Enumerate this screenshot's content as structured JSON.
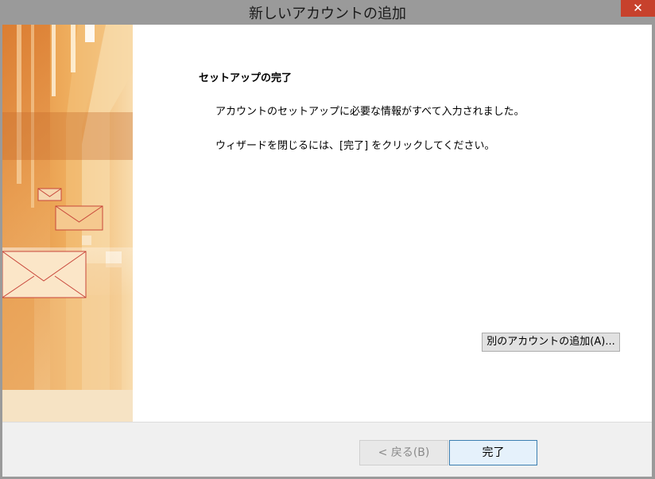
{
  "window": {
    "title": "新しいアカウントの追加",
    "close_glyph": "✕"
  },
  "content": {
    "heading": "セットアップの完了",
    "message1": "アカウントのセットアップに必要な情報がすべて入力されました。",
    "message2": "ウィザードを閉じるには、[完了] をクリックしてください。",
    "add_account_label": "別のアカウントの追加(A)..."
  },
  "footer": {
    "back_label": "< 戻る(B)",
    "finish_label": "完了"
  },
  "colors": {
    "close_button": "#c7412c",
    "banner_orange": "#e8a050",
    "finish_border": "#3c7fb1"
  },
  "icons": [
    "close-icon",
    "envelope-icon"
  ]
}
